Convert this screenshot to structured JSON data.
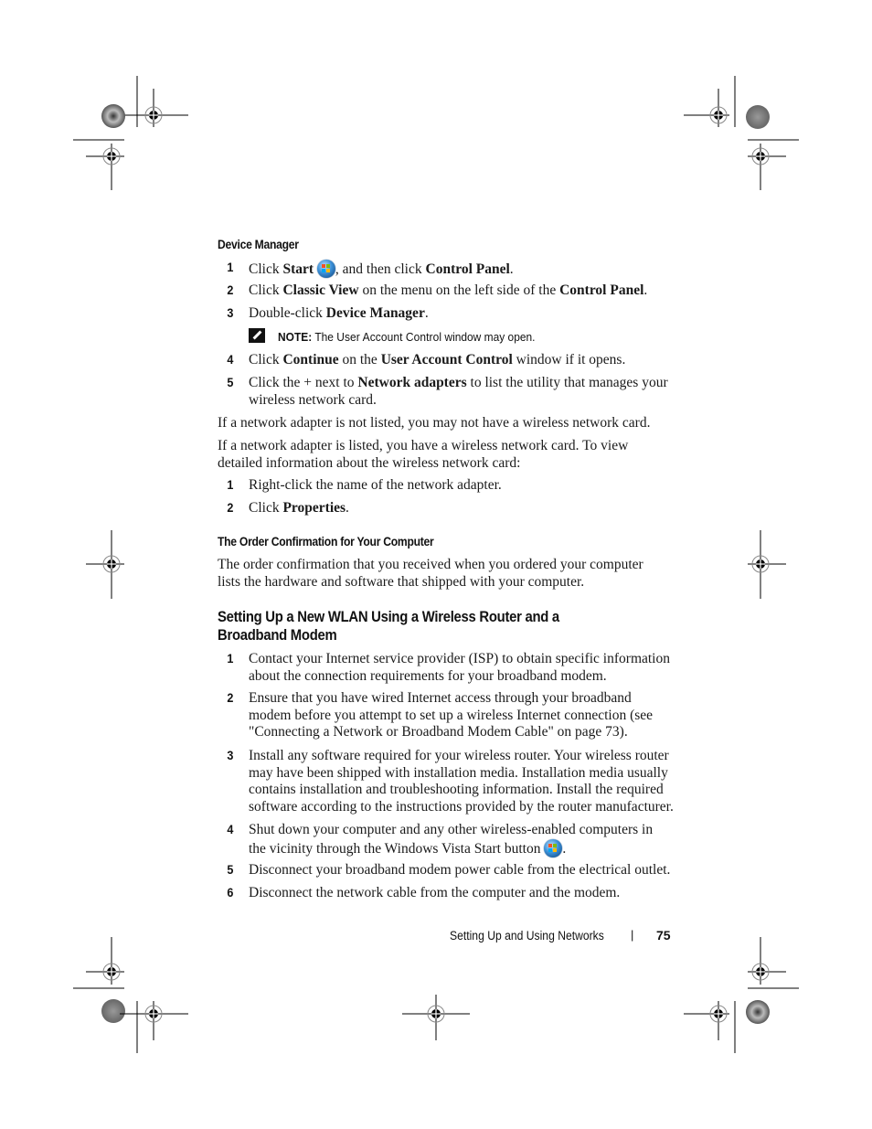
{
  "device_manager": {
    "heading": "Device Manager",
    "steps": [
      {
        "num": "1",
        "parts": [
          "Click ",
          "Start",
          ", and then click ",
          "Control Panel",
          "."
        ]
      },
      {
        "num": "2",
        "parts": [
          "Click ",
          "Classic View",
          " on the menu on the left side of the ",
          "Control Panel",
          "."
        ]
      },
      {
        "num": "3",
        "parts": [
          "Double-click ",
          "Device Manager",
          "."
        ]
      },
      {
        "num": "4",
        "parts": [
          "Click ",
          "Continue",
          " on the ",
          "User Account Control",
          " window if it opens."
        ]
      },
      {
        "num": "5",
        "parts": [
          "Click the + next to ",
          "Network adapters",
          " to list the utility that manages your",
          "wireless network card."
        ]
      }
    ],
    "note": {
      "label": "NOTE:",
      "text_pre": " The ",
      "text_bold": "User Account Control",
      "text_post": " window may open."
    },
    "para1": "If a network adapter is not listed, you may not have a wireless network card.",
    "para2_line1": "If a network adapter is listed, you have a wireless network card. To view",
    "para2_line2": "detailed information about the wireless network card:",
    "substeps": [
      {
        "num": "1",
        "text": "Right-click the name of the network adapter."
      },
      {
        "num": "2",
        "parts": [
          "Click ",
          "Properties",
          "."
        ]
      }
    ]
  },
  "order_confirmation": {
    "heading": "The Order Confirmation for Your Computer",
    "line1": "The order confirmation that you received when you ordered your computer",
    "line2": "lists the hardware and software that shipped with your computer."
  },
  "wlan_setup": {
    "heading_line1": "Setting Up a New WLAN Using a Wireless Router and a",
    "heading_line2": "Broadband Modem",
    "steps": [
      {
        "num": "1",
        "lines": [
          "Contact your Internet service provider (ISP) to obtain specific information",
          "about the connection requirements for your broadband modem."
        ]
      },
      {
        "num": "2",
        "lines": [
          "Ensure that you have wired Internet access through your broadband",
          "modem before you attempt to set up a wireless Internet connection (see",
          "\"Connecting a Network or Broadband Modem Cable\" on page 73)."
        ]
      },
      {
        "num": "3",
        "lines": [
          "Install any software required for your wireless router. Your wireless router",
          "may have been shipped with installation media. Installation media usually",
          "contains installation and troubleshooting information. Install the required",
          "software according to the instructions provided by the router manufacturer."
        ]
      },
      {
        "num": "4",
        "lines": [
          "Shut down your computer and any other wireless-enabled computers in",
          "the vicinity through the Windows Vista Start button",
          "."
        ]
      },
      {
        "num": "5",
        "lines": [
          "Disconnect your broadband modem power cable from the electrical outlet."
        ]
      },
      {
        "num": "6",
        "lines": [
          "Disconnect the network cable from the computer and the modem."
        ]
      }
    ]
  },
  "footer": {
    "section": "Setting Up and Using Networks",
    "separator": "|",
    "page_number": "75"
  },
  "icons": {
    "start_button": "windows-vista-start-icon",
    "note": "pencil-note-icon",
    "registration": "crop-registration-mark"
  }
}
